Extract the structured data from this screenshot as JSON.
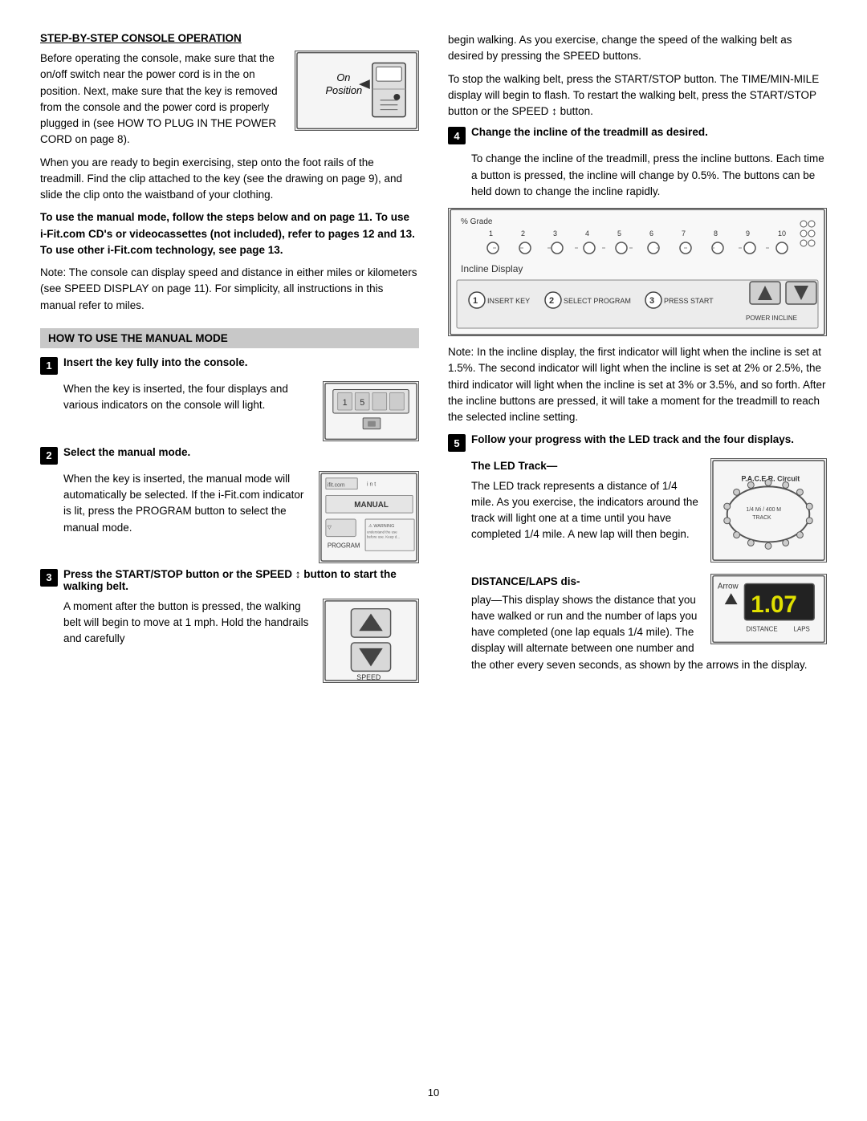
{
  "page": {
    "number": "10",
    "left_column": {
      "section_heading": "STEP-BY-STEP CONSOLE OPERATION",
      "intro_text": "Before operating the console, make sure that the on/off switch near the power cord is in the on position. Next, make sure that the key is removed from the console and the power cord is properly plugged in (see HOW TO PLUG IN THE POWER CORD on page 8).",
      "on_position_label_line1": "On",
      "on_position_label_line2": "Position",
      "exercise_text": "When you are ready to begin exercising, step onto the foot rails of the treadmill. Find the clip attached to the key (see the drawing on page 9), and slide the clip onto the waistband of your clothing.",
      "bold_para": "To use the manual mode, follow the steps below and on page 11. To use i-Fit.com CD's or videocassettes (not included), refer to pages 12 and 13. To use other i-Fit.com technology, see page 13.",
      "note_text": "Note: The console can display speed and distance in either miles or kilometers (see SPEED DISPLAY on page 11). For simplicity, all instructions in this manual refer to miles.",
      "gray_bar_label": "HOW TO USE THE MANUAL MODE",
      "steps": [
        {
          "number": "1",
          "title": "Insert the key fully into the console.",
          "body": "When the key is inserted, the four displays and various indicators on the console will light."
        },
        {
          "number": "2",
          "title": "Select the manual mode.",
          "body": "When the key is inserted, the manual mode will automatically be selected. If the i-Fit.com indicator is lit, press the PROGRAM button to select the manual mode."
        },
        {
          "number": "3",
          "title": "Press the START/STOP button or the SPEED ↕ button to start the walking belt.",
          "body": "A moment after the button is pressed, the walking belt will begin to move at 1 mph. Hold the handrails and carefully"
        }
      ]
    },
    "right_column": {
      "continue_text": "begin walking. As you exercise, change the speed of the walking belt as desired by pressing the SPEED buttons.",
      "stop_text": "To stop the walking belt, press the START/STOP button. The TIME/MIN-MILE display will begin to flash. To restart the walking belt, press the START/STOP button or the SPEED ↕ button.",
      "step4": {
        "number": "4",
        "title": "Change the incline of the treadmill as desired.",
        "body": "To change the incline of the treadmill, press the incline buttons. Each time a button is pressed, the incline will change by 0.5%. The buttons can be held down to change the incline rapidly."
      },
      "incline_label": "Incline Display",
      "incline_note": "Note: In the incline display, the first indicator will light when the incline is set at 1.5%. The second indicator will light when the incline is set at 2% or 2.5%, the third indicator will light when the incline is set at 3% or 3.5%, and so forth. After the incline buttons are pressed, it will take a moment for the treadmill to reach the selected incline setting.",
      "step5": {
        "number": "5",
        "title": "Follow your progress with the LED track and the four displays.",
        "led_heading": "The LED Track—",
        "led_body": "The LED track represents a distance of 1/4 mile. As you exercise, the indicators around the track will light one at a time until you have completed 1/4 mile. A new lap will then begin.",
        "dist_heading": "DISTANCE/LAPS dis-",
        "dist_body": "play—This display shows the distance that you have walked or run and the number of laps you have completed (one lap equals 1/4 mile). The display will alternate between one number and the other every seven seconds, as shown by the arrows in the display.",
        "arrow_label": "Arrow",
        "display_distance": "DISTANCE",
        "display_laps": "LAPS",
        "display_value": "1.07"
      }
    }
  }
}
